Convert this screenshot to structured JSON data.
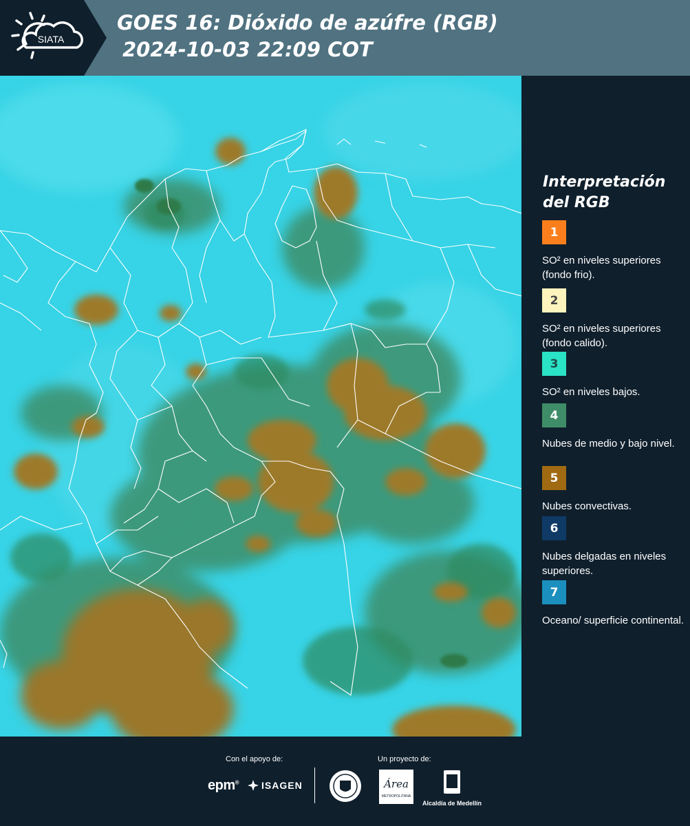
{
  "header": {
    "logo_text": "SIATA",
    "title_line1": "GOES 16: Dióxido de azúfre (RGB)",
    "title_line2": "2024-10-03 22:09 COT"
  },
  "colors": {
    "header_bg": "#507281",
    "header_dark": "#0f1f2c",
    "page_bg": "#0f1f2c",
    "map_base": "#37d3e6",
    "cloud_convective": "#9b7a2e",
    "cloud_mid_low": "#3f8f66",
    "borders": "#ffffff"
  },
  "legend": {
    "title_line1": "Interpretación",
    "title_line2": "del RGB",
    "items": [
      {
        "number": "1",
        "color": "#fa7f1c",
        "text_color": "#ffffff",
        "text": "SO² en niveles superiores (fondo frio)."
      },
      {
        "number": "2",
        "color": "#fdf3bd",
        "text_color": "#444444",
        "text": "SO² en niveles superiores (fondo calido)."
      },
      {
        "number": "3",
        "color": "#2ae2c6",
        "text_color": "#1c4a4a",
        "text": "SO² en niveles bajos."
      },
      {
        "number": "4",
        "color": "#3f8d68",
        "text_color": "#ffffff",
        "text": "Nubes de medio y bajo nivel."
      },
      {
        "number": "5",
        "color": "#a06a12",
        "text_color": "#ffffff",
        "text": "Nubes convectivas."
      },
      {
        "number": "6",
        "color": "#0f3a66",
        "text_color": "#ffffff",
        "text": "Nubes delgadas en niveles superiores."
      },
      {
        "number": "7",
        "color": "#1b8fbd",
        "text_color": "#ffffff",
        "text": "Oceano/ superficie continental."
      }
    ]
  },
  "footer": {
    "support_label": "Con el apoyo de:",
    "project_label": "Un proyecto de:",
    "epm": "epm",
    "isagen": "ISAGEN",
    "area_name": "Área",
    "area_sub": "METROPOLITANA",
    "alcaldia": "Alcaldía de Medellín"
  }
}
